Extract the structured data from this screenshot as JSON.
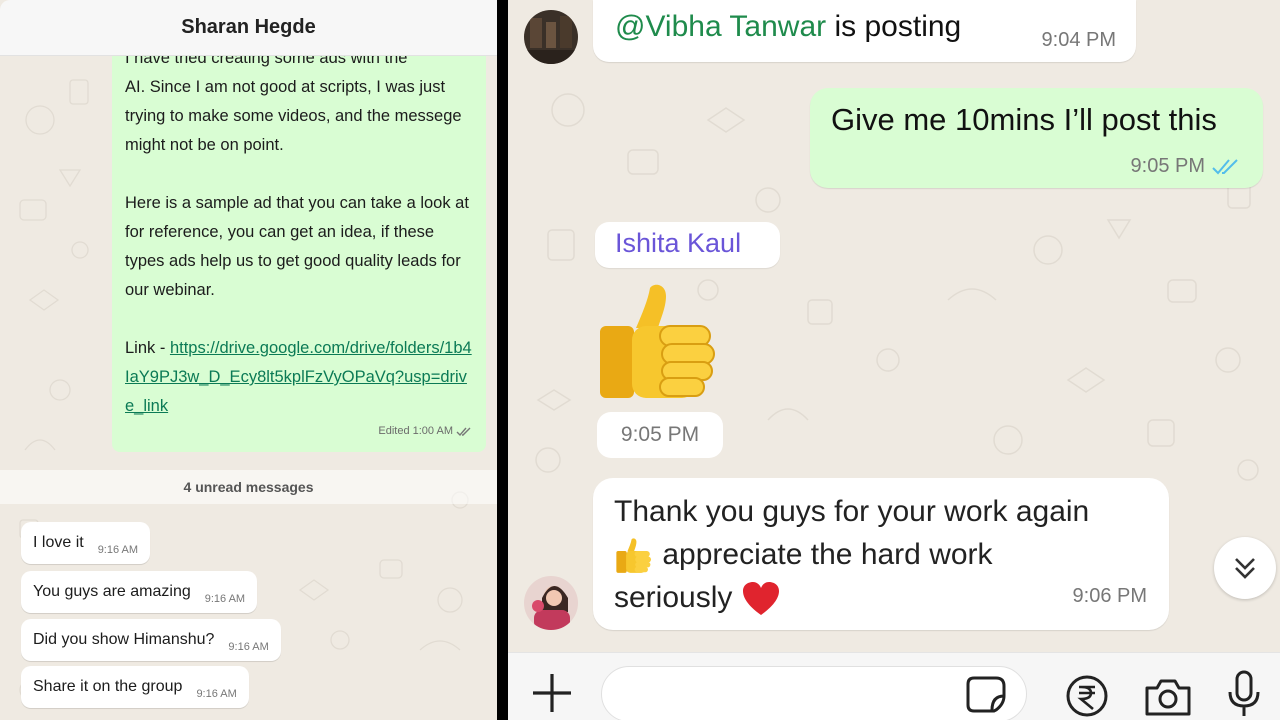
{
  "left_chat": {
    "header_title": "Sharan Hegde",
    "long_message": {
      "line_partial": "I have tried creating some ads with the",
      "para1": "AI. Since I am not good at scripts, I was just trying to make some videos, and the messege might not be on point.",
      "para2": "Here is a sample ad that you can take a look at for reference, you can get an idea, if these types ads help us to get good quality leads for our webinar.",
      "link_prefix": "Link - ",
      "link_text": "https://drive.google.com/drive/folders/1b4IaY9PJ3w_D_Ecy8lt5kplFzVyOPaVq?usp=drive_link",
      "meta": "Edited 1:00 AM"
    },
    "unread_label": "4 unread messages",
    "messages": [
      {
        "text": "I love it",
        "time": "9:16 AM"
      },
      {
        "text": "You guys are amazing",
        "time": "9:16 AM"
      },
      {
        "text": "Did you show Himanshu?",
        "time": "9:16 AM"
      },
      {
        "text": "Share it on the group",
        "time": "9:16 AM"
      }
    ]
  },
  "right_chat": {
    "top_message": {
      "mention": "@Vibha Tanwar",
      "rest": " is posting",
      "time": "9:04 PM"
    },
    "outgoing": {
      "text": "Give me 10mins I’ll post this",
      "time": "9:05 PM"
    },
    "sender_name": "Ishita Kaul",
    "thumbs_time": "9:05 PM",
    "incoming": {
      "line1": "Thank you guys for your work again",
      "line2": "appreciate the hard work",
      "line3": "seriously",
      "time": "9:06 PM"
    },
    "input_placeholder": ""
  },
  "icons": {
    "read_receipt": "double-check-icon",
    "scroll": "chevrons-down-icon",
    "attach": "plus-icon",
    "sticker": "sticker-icon",
    "payment": "rupee-icon",
    "camera": "camera-icon",
    "mic": "microphone-icon"
  },
  "colors": {
    "chat_bg": "#efeae2",
    "outgoing_bubble": "#d9fdd3",
    "incoming_bubble": "#ffffff",
    "mention": "#1f8b4c",
    "sender_name": "#6a55d8",
    "link": "#0b7a55",
    "read_tick": "#53bdeb"
  }
}
